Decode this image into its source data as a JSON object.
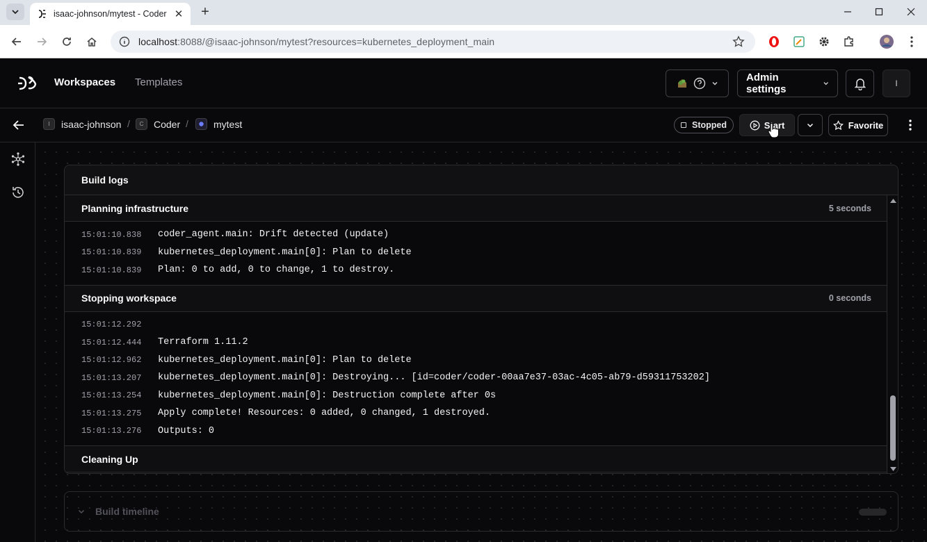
{
  "browser": {
    "tab_title": "isaac-johnson/mytest - Coder",
    "url_host": "localhost",
    "url_rest": ":8088/@isaac-johnson/mytest?resources=kubernetes_deployment_main"
  },
  "nav": {
    "workspaces": "Workspaces",
    "templates": "Templates",
    "admin_settings": "Admin settings",
    "user_initial": "I"
  },
  "breadcrumb": {
    "owner_initial": "I",
    "owner": "isaac-johnson",
    "org_initial": "C",
    "org": "Coder",
    "workspace": "mytest",
    "sep": "/"
  },
  "actions": {
    "status": "Stopped",
    "start": "Start",
    "favorite": "Favorite"
  },
  "build_logs": {
    "title": "Build logs",
    "stages": [
      {
        "name": "Planning infrastructure",
        "duration": "5 seconds",
        "lines": [
          {
            "ts": "15:01:10.838",
            "msg": "coder_agent.main: Drift detected (update)"
          },
          {
            "ts": "15:01:10.839",
            "msg": "kubernetes_deployment.main[0]: Plan to delete"
          },
          {
            "ts": "15:01:10.839",
            "msg": "Plan: 0 to add, 0 to change, 1 to destroy."
          }
        ]
      },
      {
        "name": "Stopping workspace",
        "duration": "0 seconds",
        "lines": [
          {
            "ts": "15:01:12.292",
            "msg": ""
          },
          {
            "ts": "15:01:12.444",
            "msg": "Terraform 1.11.2"
          },
          {
            "ts": "15:01:12.962",
            "msg": "kubernetes_deployment.main[0]: Plan to delete"
          },
          {
            "ts": "15:01:13.207",
            "msg": "kubernetes_deployment.main[0]: Destroying... [id=coder/coder-00aa7e37-03ac-4c05-ab79-d59311753202]"
          },
          {
            "ts": "15:01:13.254",
            "msg": "kubernetes_deployment.main[0]: Destruction complete after 0s"
          },
          {
            "ts": "15:01:13.275",
            "msg": "Apply complete! Resources: 0 added, 0 changed, 1 destroyed."
          },
          {
            "ts": "15:01:13.276",
            "msg": "Outputs: 0"
          }
        ]
      },
      {
        "name": "Cleaning Up",
        "duration": "",
        "lines": []
      }
    ]
  },
  "timeline": {
    "label": "Build timeline"
  }
}
